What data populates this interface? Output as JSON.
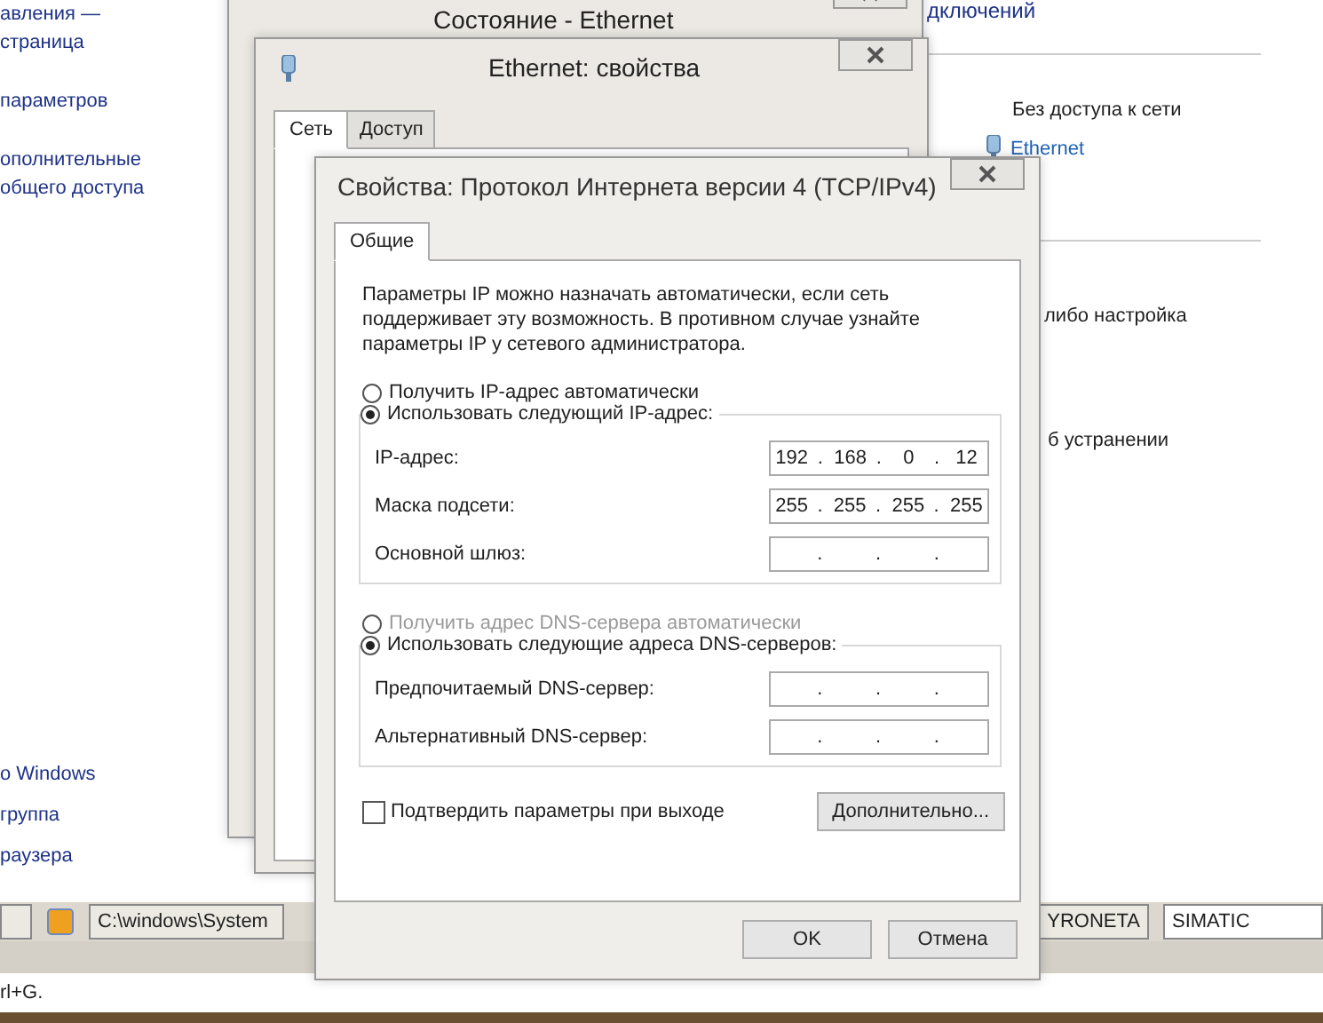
{
  "control_panel": {
    "left_texts": [
      "авления —",
      "страница",
      "параметров",
      "ополнительные",
      "общего доступа"
    ],
    "left_bottom_links": [
      "о Windows",
      "группа",
      "раузера"
    ],
    "top_right_text": "дключений",
    "network_status": "Без доступа к сети",
    "connection_link": "Ethernet",
    "right_texts": [
      "либо настройка",
      "б устранении"
    ]
  },
  "taskbar_items": [
    {
      "label": "C:\\windows\\System"
    },
    {
      "label": "YRONETA"
    },
    {
      "label": "SIMATIC"
    }
  ],
  "hint_text": "rl+G.",
  "status_window": {
    "title": "Состояние - Ethernet"
  },
  "properties_window": {
    "title": "Ethernet: свойства",
    "tabs": [
      {
        "label": "Сеть",
        "selected": true
      },
      {
        "label": "Доступ",
        "selected": false
      }
    ]
  },
  "ipv4_dialog": {
    "title": "Свойства: Протокол Интернета версии 4 (TCP/IPv4)",
    "tabs": [
      {
        "label": "Общие",
        "selected": true
      }
    ],
    "description": "Параметры IP можно назначать автоматически, если сеть поддерживает эту возможность. В противном случае узнайте параметры IP у сетевого администратора.",
    "ip_options": [
      {
        "label": "Получить IP-адрес автоматически",
        "selected": false,
        "disabled": false
      },
      {
        "label": "Использовать следующий IP-адрес:",
        "selected": true,
        "disabled": false
      }
    ],
    "octet_separator": ".",
    "ip_fields": [
      {
        "label": "IP-адрес:",
        "octets": [
          "192",
          "168",
          "0",
          "12"
        ]
      },
      {
        "label": "Маска подсети:",
        "octets": [
          "255",
          "255",
          "255",
          "255"
        ]
      },
      {
        "label": "Основной шлюз:"
      }
    ],
    "dns_options": [
      {
        "label": "Получить адрес DNS-сервера автоматически",
        "selected": false,
        "disabled": true
      },
      {
        "label": "Использовать следующие адреса DNS-серверов:",
        "selected": true,
        "disabled": false
      }
    ],
    "dns_fields": [
      {
        "label": "Предпочитаемый DNS-сервер:"
      },
      {
        "label": "Альтернативный DNS-сервер:"
      }
    ],
    "validate_on_exit": {
      "label": "Подтвердить параметры при выходе",
      "checked": false
    },
    "advanced_button": "Дополнительно...",
    "buttons": [
      "OK",
      "Отмена"
    ]
  }
}
